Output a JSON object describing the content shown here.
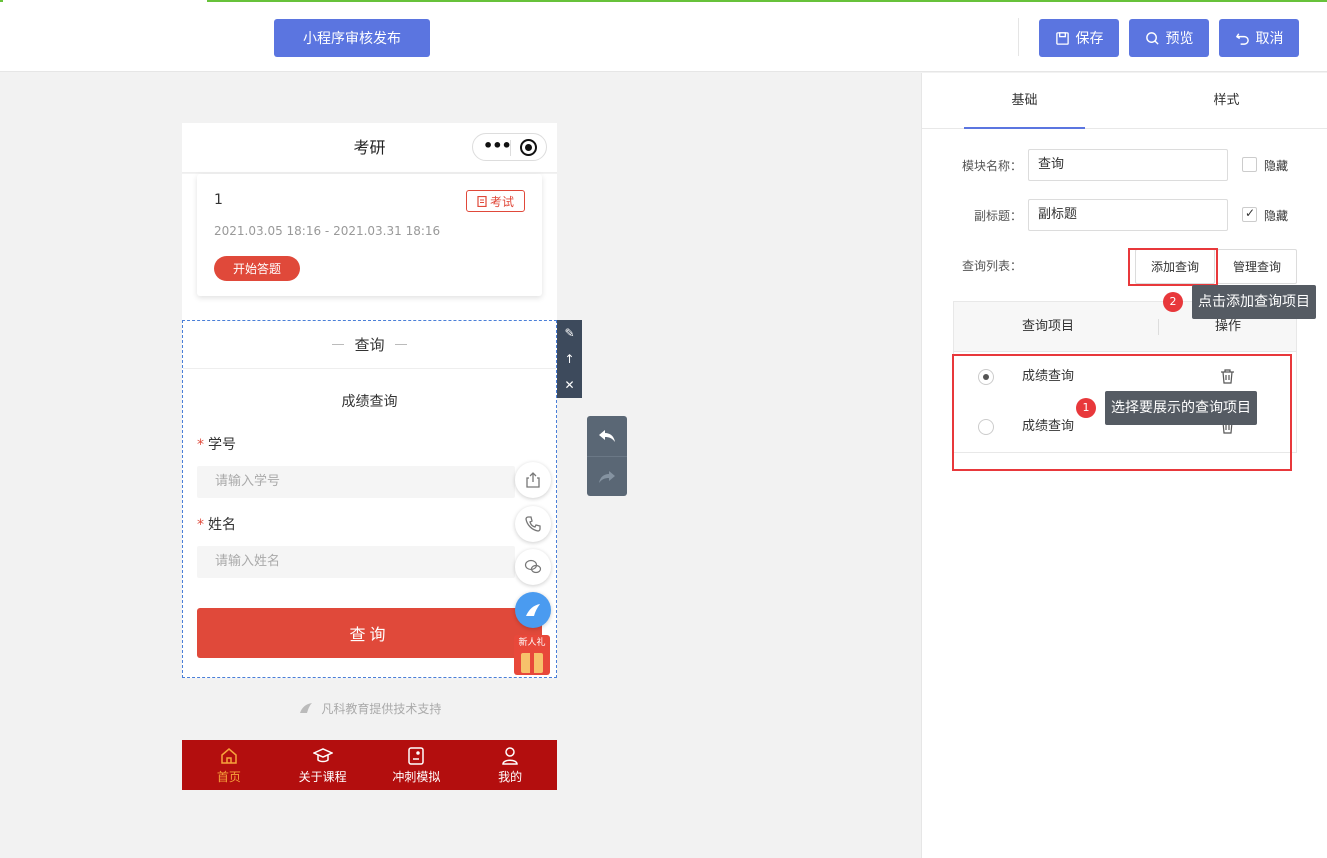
{
  "toolbar": {
    "publish_label": "小程序审核发布",
    "save_label": "保存",
    "preview_label": "预览",
    "cancel_label": "取消"
  },
  "phone": {
    "title": "考研",
    "exam": {
      "number": "1",
      "tag": "考试",
      "date_range": "2021.03.05 18:16 - 2021.03.31 18:16",
      "start_label": "开始答题"
    },
    "query": {
      "header": "查询",
      "title": "成绩查询",
      "field1_label": "学号",
      "field1_placeholder": "请输入学号",
      "field2_label": "姓名",
      "field2_placeholder": "请输入姓名",
      "submit_label": "查询"
    },
    "gift_label": "新人礼",
    "support_text": "凡科教育提供技术支持",
    "tabs": [
      {
        "label": "首页",
        "icon": "home-icon",
        "active": true
      },
      {
        "label": "关于课程",
        "icon": "graduation-cap-icon",
        "active": false
      },
      {
        "label": "冲刺模拟",
        "icon": "quiz-icon",
        "active": false
      },
      {
        "label": "我的",
        "icon": "user-icon",
        "active": false
      }
    ]
  },
  "panel": {
    "tabs": [
      "基础",
      "样式"
    ],
    "module_name_label": "模块名称：",
    "module_name_value": "查询",
    "hide_label": "隐藏",
    "subtitle_label": "副标题：",
    "subtitle_value": "副标题",
    "subtitle_hide_label": "隐藏",
    "query_list_label": "查询列表：",
    "add_query_label": "添加查询",
    "manage_query_label": "管理查询",
    "table_headers": [
      "查询项目",
      "操作"
    ],
    "rows": [
      {
        "name": "成绩查询",
        "selected": true
      },
      {
        "name": "成绩查询",
        "selected": false
      }
    ],
    "tip1_badge": "1",
    "tip1_text": "选择要展示的查询项目",
    "tip2_badge": "2",
    "tip2_text": "点击添加查询项目"
  },
  "colors": {
    "primary": "#5b75e0",
    "red": "#e0493a",
    "tabbar": "#b30e0e",
    "annotation": "#e8383b"
  }
}
